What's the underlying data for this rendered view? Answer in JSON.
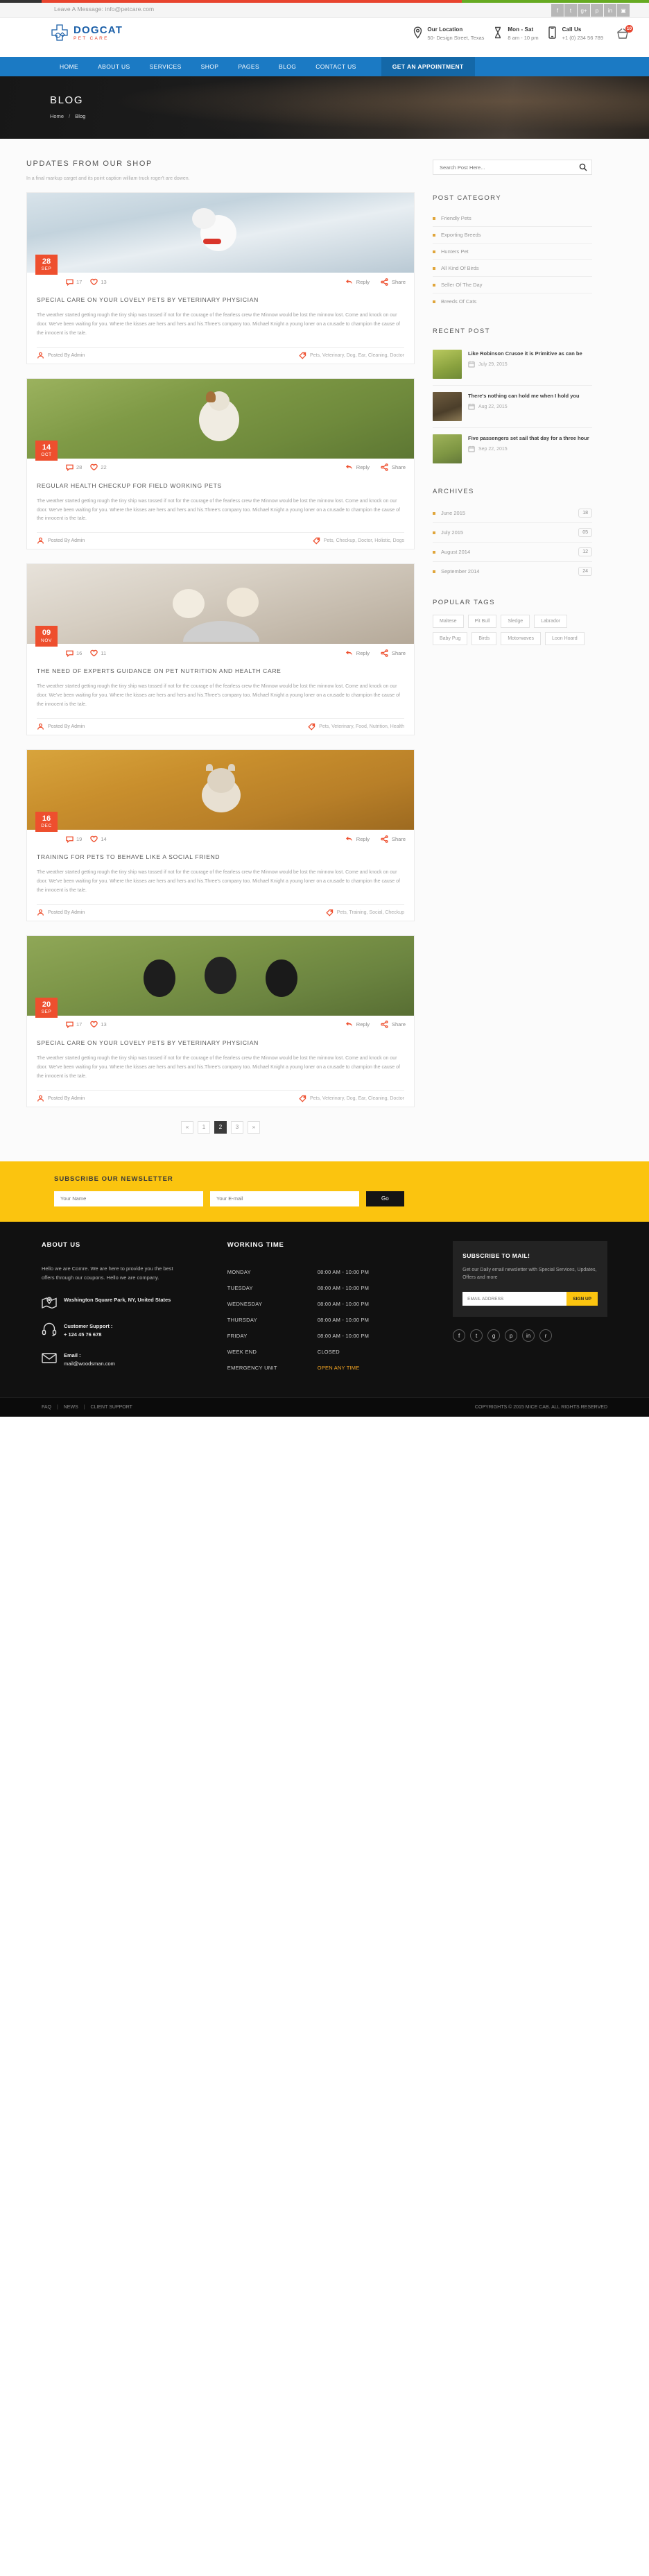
{
  "topbar": {
    "message": "Leave A Message: info@petcare.com",
    "social": [
      {
        "name": "facebook-icon",
        "glyph": "f"
      },
      {
        "name": "twitter-icon",
        "glyph": "t"
      },
      {
        "name": "google-plus-icon",
        "glyph": "g"
      },
      {
        "name": "pinterest-icon",
        "glyph": "p"
      },
      {
        "name": "linkedin-icon",
        "glyph": "in"
      },
      {
        "name": "instagram-icon",
        "glyph": "ig"
      }
    ]
  },
  "header": {
    "logo_title": "DOGCAT",
    "logo_subtitle": "PET CARE",
    "info": [
      {
        "icon": "location-pin-icon",
        "title": "Our Location",
        "sub": "50- Design Street, Texas"
      },
      {
        "icon": "hourglass-icon",
        "title": "Mon - Sat",
        "sub": "8 am - 10 pm"
      },
      {
        "icon": "mobile-phone-icon",
        "title": "Call Us",
        "sub": "+1 (0) 234 56 789"
      }
    ],
    "cart_count": "10"
  },
  "nav": {
    "items": [
      "HOME",
      "ABOUT US",
      "SERVICES",
      "SHOP",
      "PAGES",
      "BLOG",
      "CONTACT US"
    ],
    "cta": "GET AN APPOINTMENT"
  },
  "banner": {
    "title": "BLOG",
    "crumb_home": "Home",
    "crumb_sep": "/",
    "crumb_current": "Blog"
  },
  "main": {
    "section_title": "UPDATES FROM OUR SHOP",
    "section_sub": "In a final markup carget and its point caption william truck roger't are dowen.",
    "excerpt": "The weather started getting rough the tiny ship was tossed if not for the courage of the fearless crew the Minnow would be lost the minnow lost. Come and knock on our door. We've been waiting for you. Where the kisses are hers and hers and his.Three's company too. Michael Knight a young loner on a crusade to champion the cause of the innocent is the tale.",
    "reply_label": "Reply",
    "share_label": "Share",
    "posted_by": "Posted By  Admin",
    "posts": [
      {
        "date_month": "SEP",
        "date_day": "28",
        "comments": "17",
        "likes": "13",
        "title": "SPECIAL CARE ON YOUR LOVELY PETS BY VETERINARY PHYSICIAN",
        "tags": "Pets, Veterinary, Dog, Ear, Cleaning, Doctor",
        "thumb_class": "ph-1"
      },
      {
        "date_month": "OCT",
        "date_day": "14",
        "comments": "28",
        "likes": "22",
        "title": "REGULAR HEALTH CHECKUP FOR FIELD WORKING PETS",
        "tags": "Pets, Checkup, Doctor, Holistic, Dogs",
        "thumb_class": "ph-2"
      },
      {
        "date_month": "NOV",
        "date_day": "09",
        "comments": "16",
        "likes": "11",
        "title": "THE NEED OF EXPERTS GUIDANCE ON PET NUTRITION AND HEALTH CARE",
        "tags": "Pets, Veterinary, Food, Nutrition, Health",
        "thumb_class": "ph-3"
      },
      {
        "date_month": "DEC",
        "date_day": "16",
        "comments": "19",
        "likes": "14",
        "title": "TRAINING FOR PETS TO BEHAVE LIKE A SOCIAL FRIEND",
        "tags": "Pets, Training, Social, Checkup",
        "thumb_class": "ph-4"
      },
      {
        "date_month": "SEP",
        "date_day": "20",
        "comments": "17",
        "likes": "13",
        "title": "SPECIAL CARE ON YOUR LOVELY PETS BY VETERINARY PHYSICIAN",
        "tags": "Pets, Veterinary, Dog, Ear, Cleaning, Doctor",
        "thumb_class": "ph-5"
      }
    ],
    "pagination": [
      "«",
      "1",
      "2",
      "3",
      "»"
    ],
    "pagination_active": "2"
  },
  "sidebar": {
    "search_placeholder": "Search Post Here...",
    "post_category_title": "POST CATEGORY",
    "categories": [
      "Friendly Pets",
      "Exporting Breeds",
      "Hunters Pet",
      "All Kind Of Birds",
      "Seller Of The Day",
      "Breeds Of Cats"
    ],
    "recent_post_title": "RECENT POST",
    "recent_posts": [
      {
        "title": "Like Robinson Crusoe it is Primitive as can be",
        "date": "July 29, 2015",
        "thumb_class": "rpt-1"
      },
      {
        "title": "There's nothing can hold me when I hold you",
        "date": "Aug 22, 2015",
        "thumb_class": "rpt-2"
      },
      {
        "title": "Five passengers set sail that day for a three hour",
        "date": "Sep 22, 2015",
        "thumb_class": "rpt-3"
      }
    ],
    "archives_title": "ARCHIVES",
    "archives": [
      {
        "label": "June 2015",
        "count": "18"
      },
      {
        "label": "July 2015",
        "count": "05"
      },
      {
        "label": "August 2014",
        "count": "12"
      },
      {
        "label": "September 2014",
        "count": "24"
      }
    ],
    "popular_tags_title": "POPULAR TAGS",
    "tags": [
      "Maltese",
      "Pit Bull",
      "Sledge",
      "Labrador",
      "Baby Pug",
      "Birds",
      "Motorwaves",
      "Loon Hoard"
    ]
  },
  "newsletter": {
    "title": "SUBSCRIBE OUR NEWSLETTER",
    "name_placeholder": "Your Name",
    "email_placeholder": "Your E-mail",
    "button": "Go"
  },
  "footer": {
    "about_title": "ABOUT US",
    "about_text": "Hello we are Comre. We are here to provide you the best offers through our coupons. Hello we are company.",
    "address": "Washington Square Park, NY, United States",
    "support_label": "Customer Support :",
    "support_phone": "+ 124 45 76 678",
    "email_label": "Email :",
    "email_value": "mail@woodsman.com",
    "working_title": "WORKING TIME",
    "working_rows": [
      {
        "day": "MONDAY",
        "time": "08:00 AM - 10:00 PM",
        "style": "normal"
      },
      {
        "day": "TUESDAY",
        "time": "08:00 AM - 10:00 PM",
        "style": "normal"
      },
      {
        "day": "WEDNESDAY",
        "time": "08:00 AM - 10:00 PM",
        "style": "normal"
      },
      {
        "day": "THURSDAY",
        "time": "08:00 AM - 10:00 PM",
        "style": "normal"
      },
      {
        "day": "FRIDAY",
        "time": "08:00 AM - 10:00 PM",
        "style": "normal"
      },
      {
        "day": "WEEK END",
        "time": "CLOSED",
        "style": "closed"
      },
      {
        "day": "EMERGENCY UNIT",
        "time": "OPEN ANY TIME",
        "style": "open"
      }
    ],
    "subscribe_title": "SUBSCRIBE TO MAIL!",
    "subscribe_text": "Get our Daily email newsletter with Special Services, Updates, Offers and more",
    "subscribe_placeholder": "EMAIL ADDRESS",
    "subscribe_button": "SIGN UP",
    "social": [
      {
        "name": "facebook-icon",
        "glyph": "f"
      },
      {
        "name": "twitter-icon",
        "glyph": "t"
      },
      {
        "name": "google-plus-icon",
        "glyph": "g"
      },
      {
        "name": "pinterest-icon",
        "glyph": "p"
      },
      {
        "name": "linkedin-icon",
        "glyph": "in"
      },
      {
        "name": "rss-icon",
        "glyph": "r"
      }
    ],
    "bottom_links": [
      "FAQ",
      "NEWS",
      "CLIENT SUPPORT"
    ],
    "bottom_separator": "|",
    "copyright": "COPYRIGHTS © 2015 MICE CAB. ALL RIGHTS RESERVED"
  },
  "colors": {
    "brand_blue": "#1b7ac4",
    "accent_red": "#ee4f2e",
    "yellow": "#fbc40f",
    "logo_blue": "#1b5fa8"
  }
}
